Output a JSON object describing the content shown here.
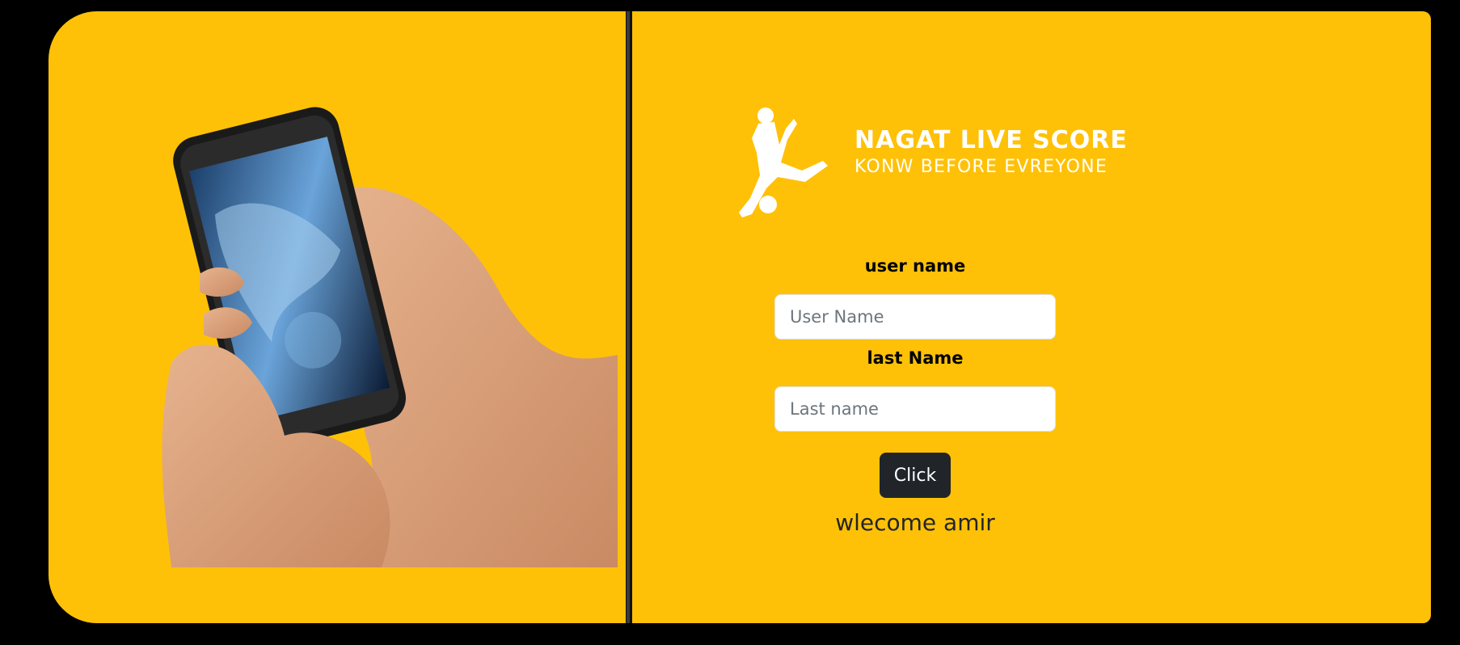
{
  "brand": {
    "title": "NAGAT LIVE SCORE",
    "tagline": "KONW BEFORE EVREYONE",
    "logo_icon": "soccer-player-icon"
  },
  "illustration": {
    "icon": "hand-holding-phone-image"
  },
  "form": {
    "username_label": "user name",
    "username_placeholder": "User Name",
    "username_value": "",
    "lastname_label": "last Name",
    "lastname_placeholder": "Last name",
    "lastname_value": "",
    "submit_label": "Click",
    "welcome_message": "wlecome amir"
  },
  "colors": {
    "background": "#000000",
    "panel": "#ffc107",
    "button": "#212529",
    "brand_text": "#ffffff"
  }
}
